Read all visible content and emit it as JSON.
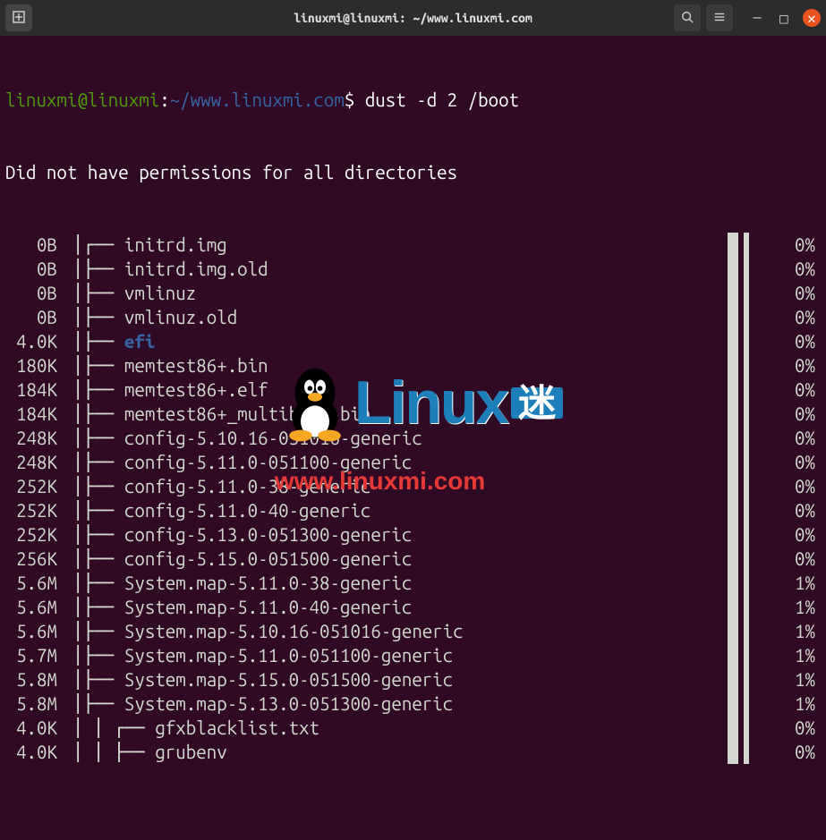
{
  "titlebar": {
    "title": "linuxmi@linuxmi: ~/www.linuxmi.com",
    "new_tab_icon": "⊞",
    "search_icon": "🔍",
    "menu_icon": "≡",
    "minimize_icon": "—",
    "maximize_icon": "□",
    "close_icon": "✕"
  },
  "prompt": {
    "user": "linuxmi@linuxmi",
    "sep": ":",
    "path": "~/www.linuxmi.com",
    "symbol": "$",
    "command": "dust -d 2 /boot"
  },
  "message": "Did not have permissions for all directories",
  "rows": [
    {
      "size": "0B",
      "tree": "┌── ",
      "name": "initrd.img",
      "dir": false,
      "pct": "0%",
      "depth": 1
    },
    {
      "size": "0B",
      "tree": "├── ",
      "name": "initrd.img.old",
      "dir": false,
      "pct": "0%",
      "depth": 1
    },
    {
      "size": "0B",
      "tree": "├── ",
      "name": "vmlinuz",
      "dir": false,
      "pct": "0%",
      "depth": 1
    },
    {
      "size": "0B",
      "tree": "├── ",
      "name": "vmlinuz.old",
      "dir": false,
      "pct": "0%",
      "depth": 1
    },
    {
      "size": "4.0K",
      "tree": "├── ",
      "name": "efi",
      "dir": true,
      "pct": "0%",
      "depth": 1
    },
    {
      "size": "180K",
      "tree": "├── ",
      "name": "memtest86+.bin",
      "dir": false,
      "pct": "0%",
      "depth": 1
    },
    {
      "size": "184K",
      "tree": "├── ",
      "name": "memtest86+.elf",
      "dir": false,
      "pct": "0%",
      "depth": 1
    },
    {
      "size": "184K",
      "tree": "├── ",
      "name": "memtest86+_multiboot.bin",
      "dir": false,
      "pct": "0%",
      "depth": 1
    },
    {
      "size": "248K",
      "tree": "├── ",
      "name": "config-5.10.16-051016-generic",
      "dir": false,
      "pct": "0%",
      "depth": 1
    },
    {
      "size": "248K",
      "tree": "├── ",
      "name": "config-5.11.0-051100-generic",
      "dir": false,
      "pct": "0%",
      "depth": 1
    },
    {
      "size": "252K",
      "tree": "├── ",
      "name": "config-5.11.0-38-generic",
      "dir": false,
      "pct": "0%",
      "depth": 1
    },
    {
      "size": "252K",
      "tree": "├── ",
      "name": "config-5.11.0-40-generic",
      "dir": false,
      "pct": "0%",
      "depth": 1
    },
    {
      "size": "252K",
      "tree": "├── ",
      "name": "config-5.13.0-051300-generic",
      "dir": false,
      "pct": "0%",
      "depth": 1
    },
    {
      "size": "256K",
      "tree": "├── ",
      "name": "config-5.15.0-051500-generic",
      "dir": false,
      "pct": "0%",
      "depth": 1
    },
    {
      "size": "5.6M",
      "tree": "├── ",
      "name": "System.map-5.11.0-38-generic",
      "dir": false,
      "pct": "1%",
      "depth": 1
    },
    {
      "size": "5.6M",
      "tree": "├── ",
      "name": "System.map-5.11.0-40-generic",
      "dir": false,
      "pct": "1%",
      "depth": 1
    },
    {
      "size": "5.6M",
      "tree": "├── ",
      "name": "System.map-5.10.16-051016-generic",
      "dir": false,
      "pct": "1%",
      "depth": 1
    },
    {
      "size": "5.7M",
      "tree": "├── ",
      "name": "System.map-5.11.0-051100-generic",
      "dir": false,
      "pct": "1%",
      "depth": 1
    },
    {
      "size": "5.8M",
      "tree": "├── ",
      "name": "System.map-5.15.0-051500-generic",
      "dir": false,
      "pct": "1%",
      "depth": 1
    },
    {
      "size": "5.8M",
      "tree": "├── ",
      "name": "System.map-5.13.0-051300-generic",
      "dir": false,
      "pct": "1%",
      "depth": 1
    },
    {
      "size": "4.0K",
      "tree": " ┌── ",
      "name": "gfxblacklist.txt",
      "dir": false,
      "pct": "0%",
      "depth": 2
    },
    {
      "size": "4.0K",
      "tree": " ├── ",
      "name": "grubenv",
      "dir": false,
      "pct": "0%",
      "depth": 2
    }
  ],
  "watermark": {
    "text1": "Linux",
    "text2": "迷",
    "url": "www.linuxmi.com"
  }
}
